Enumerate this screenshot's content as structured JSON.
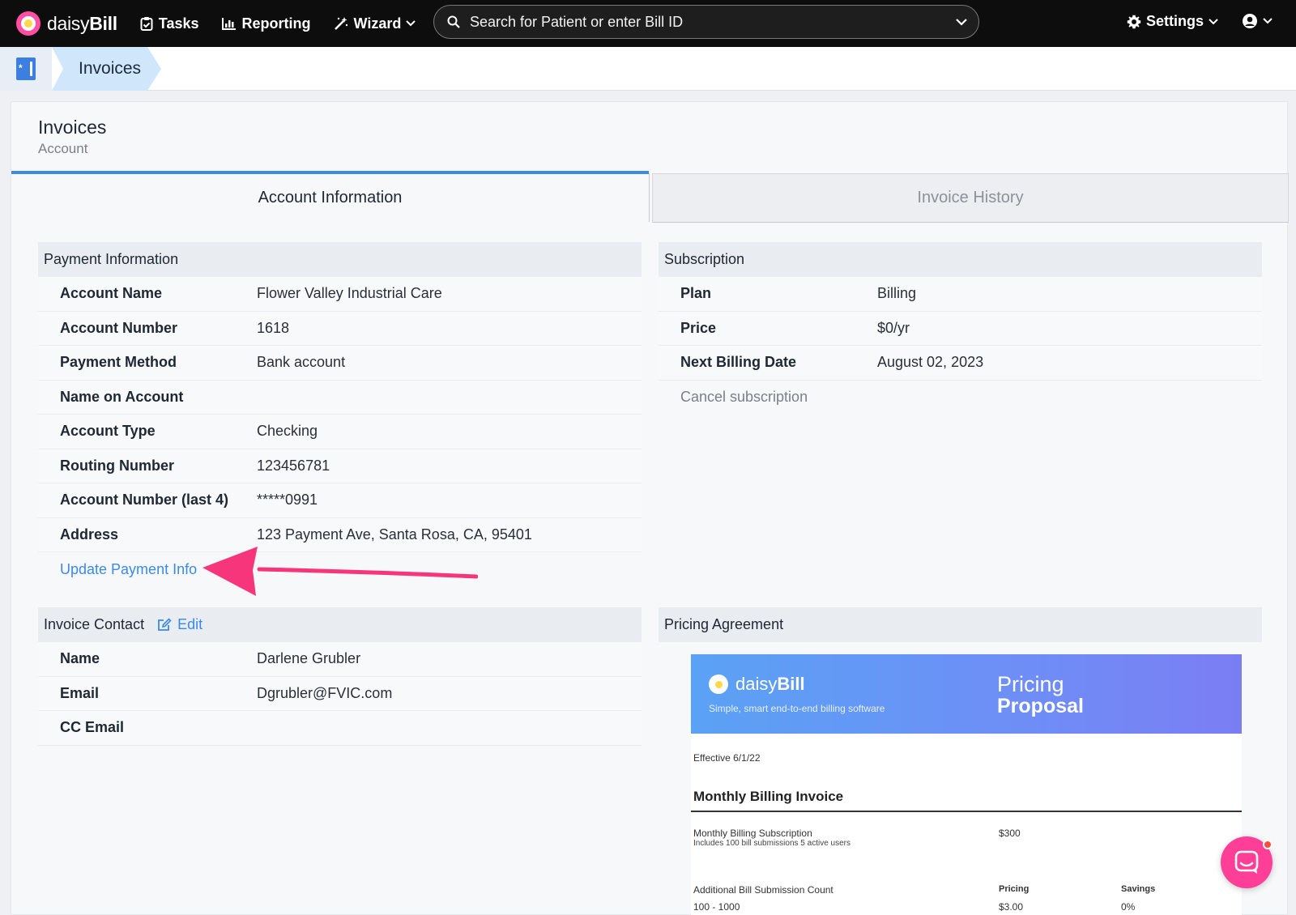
{
  "nav": {
    "brand_prefix": "daisy",
    "brand_suffix": "Bill",
    "tasks": "Tasks",
    "reporting": "Reporting",
    "wizard": "Wizard",
    "search_placeholder": "Search for Patient or enter Bill ID",
    "settings": "Settings"
  },
  "breadcrumb": {
    "current": "Invoices"
  },
  "page": {
    "title": "Invoices",
    "subtitle": "Account"
  },
  "tabs": [
    {
      "label": "Account Information",
      "active": true
    },
    {
      "label": "Invoice History",
      "active": false
    }
  ],
  "payment": {
    "heading": "Payment Information",
    "rows": [
      {
        "label": "Account Name",
        "value": "Flower Valley Industrial Care"
      },
      {
        "label": "Account Number",
        "value": "1618"
      },
      {
        "label": "Payment Method",
        "value": "Bank account"
      },
      {
        "label": "Name on Account",
        "value": ""
      },
      {
        "label": "Account Type",
        "value": "Checking"
      },
      {
        "label": "Routing Number",
        "value": "123456781"
      },
      {
        "label": "Account Number (last 4)",
        "value": "*****0991"
      },
      {
        "label": "Address",
        "value": "123 Payment Ave, Santa Rosa, CA, 95401"
      }
    ],
    "update_link": "Update Payment Info"
  },
  "subscription": {
    "heading": "Subscription",
    "rows": [
      {
        "label": "Plan",
        "value": "Billing"
      },
      {
        "label": "Price",
        "value": "$0/yr"
      },
      {
        "label": "Next Billing Date",
        "value": "August 02, 2023"
      }
    ],
    "cancel_link": "Cancel subscription"
  },
  "contact": {
    "heading": "Invoice Contact",
    "edit": "Edit",
    "rows": [
      {
        "label": "Name",
        "value": "Darlene Grubler"
      },
      {
        "label": "Email",
        "value": "Dgrubler@FVIC.com"
      },
      {
        "label": "CC Email",
        "value": ""
      }
    ]
  },
  "pricing": {
    "heading": "Pricing Agreement",
    "banner_brand_prefix": "daisy",
    "banner_brand_suffix": "Bill",
    "banner_tagline": "Simple, smart end-to-end billing software",
    "banner_title_1": "Pricing",
    "banner_title_2": "Proposal",
    "effective": "Effective 6/1/22",
    "section_title": "Monthly Billing Invoice",
    "subscription_name": "Monthly Billing Subscription",
    "subscription_includes": "Includes 100 bill submissions 5 active users",
    "subscription_price": "$300",
    "additional_label": "Additional Bill Submission Count",
    "col_pricing": "Pricing",
    "col_savings": "Savings",
    "range_1": "100 - 1000",
    "range_1_price": "$3.00",
    "range_1_savings": "0%"
  },
  "colors": {
    "accent": "#3a8ae6",
    "brand_pink": "#ff3f97",
    "annotation_arrow": "#f7357a"
  }
}
